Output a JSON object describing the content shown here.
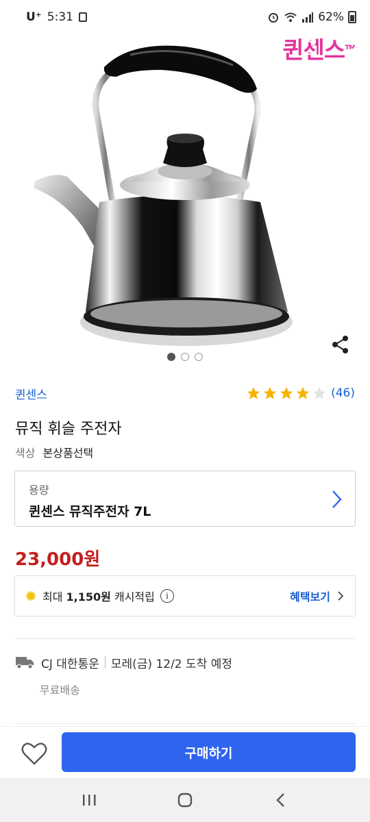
{
  "status": {
    "carrier": "U⁺",
    "time": "5:31",
    "battery": "62%"
  },
  "hero": {
    "brand_logo": "퀸센스",
    "brand_logo_tm": "TM",
    "image_count": 3,
    "active_image": 1
  },
  "product": {
    "brand": "퀸센스",
    "rating_value": 4,
    "rating_max": 5,
    "rating_count": "(46)",
    "title": "뮤직 휘슬 주전자",
    "color_label": "색상",
    "color_value": "본상품선택",
    "option_label": "용량",
    "option_value": "퀸센스 뮤직주전자 7L",
    "price": "23,000원"
  },
  "cashback": {
    "prefix": "최대",
    "amount": "1,150원",
    "suffix": "캐시적립",
    "info_icon": "i",
    "link_label": "혜택보기"
  },
  "shipping": {
    "carrier": "CJ 대한통운",
    "eta": "모레(금) 12/2 도착 예정",
    "fee": "무료배송"
  },
  "actions": {
    "buy_label": "구매하기"
  },
  "colors": {
    "link_blue": "#1a5fd6",
    "price_red": "#c41e1e",
    "buy_blue": "#2f64ef",
    "star_gold": "#f4b400",
    "brand_pink": "#e0108a"
  }
}
